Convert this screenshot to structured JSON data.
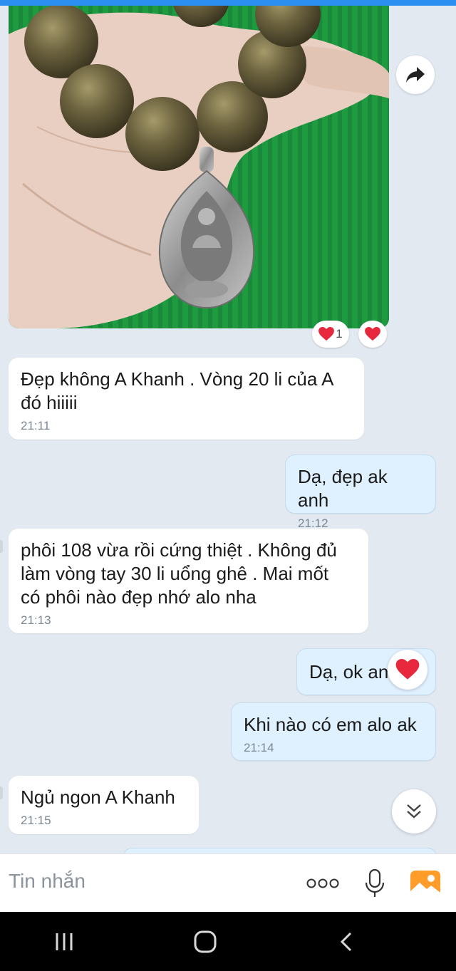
{
  "colors": {
    "accent": "#2a8ff0",
    "chat_bg": "#e2e9f1",
    "outgoing_bg": "#dff0ff",
    "incoming_bg": "#ffffff",
    "heart": "#e8283c"
  },
  "photo": {
    "icon": "forward-share-icon",
    "subject": "agarwood-bead-bracelet-with-silver-pendant"
  },
  "photo_reactions": [
    {
      "icon": "heart-icon",
      "count": "1"
    },
    {
      "icon": "heart-icon",
      "count": ""
    }
  ],
  "messages": [
    {
      "direction": "in",
      "text": "Đẹp không A Khanh . Vòng 20 li của A\nđó hiiiii",
      "time": "21:11"
    },
    {
      "direction": "out",
      "text": "Dạ, đẹp ak anh",
      "time": "21:12"
    },
    {
      "direction": "in",
      "text": "phôi 108 vừa rồi cứng thiệt . Không đủ\nlàm vòng tay 30 li uổng ghê . Mai mốt\ncó phôi nào đẹp nhớ alo nha",
      "time": "21:13"
    },
    {
      "direction": "out",
      "text": "Dạ, ok anh",
      "time": "",
      "reaction_icon": "heart-icon"
    },
    {
      "direction": "out",
      "text": "Khi nào có em alo ak",
      "time": "21:14"
    },
    {
      "direction": "in",
      "text": "Ngủ ngon A Khanh",
      "time": "21:15"
    }
  ],
  "composer": {
    "placeholder": "Tin nhắn",
    "icons": [
      "more-options-icon",
      "microphone-icon",
      "gallery-image-icon"
    ]
  },
  "scroll_button": {
    "icon": "chevrons-down-icon"
  },
  "navbar": {
    "icons": [
      "recent-apps-icon",
      "home-icon",
      "back-icon"
    ]
  }
}
